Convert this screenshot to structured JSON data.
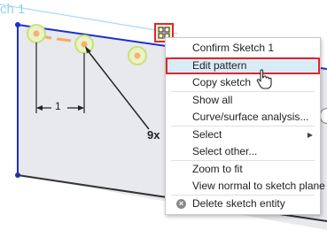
{
  "sketch": {
    "name_fragment": "ch 1",
    "dimension_label": "1",
    "pattern_count": "9x"
  },
  "context_menu": {
    "items": [
      {
        "label": "Confirm Sketch 1"
      },
      {
        "label": "Edit pattern"
      },
      {
        "label": "Copy sketch"
      },
      {
        "label": "Show all"
      },
      {
        "label": "Curve/surface analysis..."
      },
      {
        "label": "Select"
      },
      {
        "label": "Select other..."
      },
      {
        "label": "Zoom to fit"
      },
      {
        "label": "View normal to sketch plane"
      },
      {
        "label": "Delete sketch entity"
      }
    ]
  },
  "icons": {
    "pattern": "pattern-icon",
    "delete": "close-circle-icon",
    "submenu": "chevron-right-icon",
    "cursor": "hand-pointer-icon"
  },
  "colors": {
    "highlight_border": "#e1262d",
    "highlight_fill": "#d8ecf8",
    "sketch_line": "#1a2fcf",
    "selection_ring": "#c9e07a",
    "point_fill": "#f5b07a",
    "plane_fill": "#e7e9ec"
  }
}
